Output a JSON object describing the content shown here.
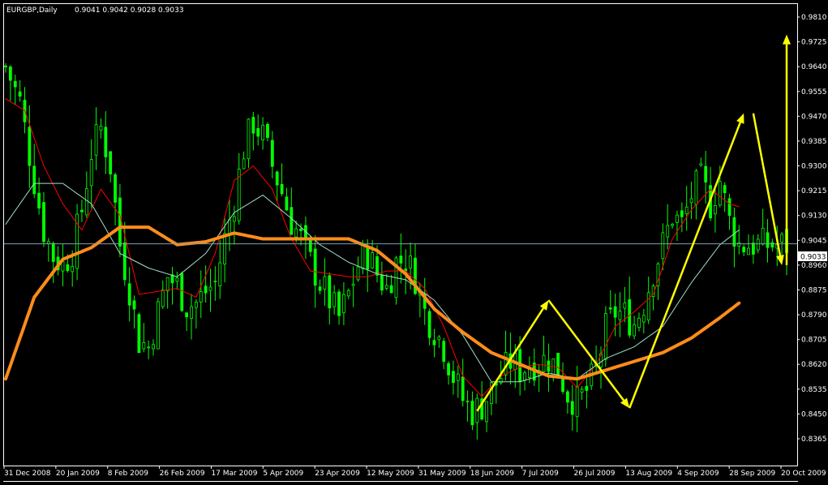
{
  "window": {
    "title": "EURGBP,Daily",
    "ohlc": "0.9041 0.9042 0.9028 0.9033"
  },
  "chart_data": {
    "type": "candlestick",
    "symbol": "EURGBP",
    "timeframe": "Daily",
    "current_price": "0.9033",
    "ylim": [
      0.8365,
      0.983
    ],
    "y_ticks": [
      "0.9810",
      "0.9725",
      "0.9640",
      "0.9555",
      "0.9470",
      "0.9385",
      "0.9300",
      "0.9215",
      "0.9130",
      "0.9045",
      "0.8960",
      "0.8875",
      "0.8790",
      "0.8705",
      "0.8620",
      "0.8535",
      "0.8450",
      "0.8365"
    ],
    "x_ticks": [
      "31 Dec 2008",
      "20 Jan 2009",
      "8 Feb 2009",
      "26 Feb 2009",
      "17 Mar 2009",
      "5 Apr 2009",
      "23 Apr 2009",
      "12 May 2009",
      "31 May 2009",
      "18 Jun 2009",
      "7 Jul 2009",
      "26 Jul 2009",
      "13 Aug 2009",
      "4 Sep 2009",
      "28 Sep 2009",
      "20 Oct 2009"
    ],
    "grid": false,
    "colors": {
      "background": "#000000",
      "candles": "#00ff00",
      "ma_fast": "#ff0000",
      "ma_mid": "#9fe0c8",
      "ma_slow": "#ff8c1a",
      "arrows": "#ffff00",
      "price_line": "#7f9fb0",
      "axis": "#ffffff"
    },
    "close_path": [
      [
        0,
        0.964
      ],
      [
        3,
        0.952
      ],
      [
        6,
        0.925
      ],
      [
        8,
        0.908
      ],
      [
        10,
        0.899
      ],
      [
        12,
        0.896
      ],
      [
        14,
        0.901
      ],
      [
        16,
        0.915
      ],
      [
        18,
        0.935
      ],
      [
        20,
        0.943
      ],
      [
        22,
        0.93
      ],
      [
        24,
        0.903
      ],
      [
        26,
        0.888
      ],
      [
        28,
        0.87
      ],
      [
        30,
        0.868
      ],
      [
        32,
        0.88
      ],
      [
        34,
        0.892
      ],
      [
        36,
        0.889
      ],
      [
        38,
        0.882
      ],
      [
        40,
        0.883
      ],
      [
        42,
        0.887
      ],
      [
        44,
        0.89
      ],
      [
        46,
        0.905
      ],
      [
        48,
        0.918
      ],
      [
        50,
        0.936
      ],
      [
        52,
        0.945
      ],
      [
        54,
        0.94
      ],
      [
        56,
        0.93
      ],
      [
        58,
        0.921
      ],
      [
        60,
        0.911
      ],
      [
        62,
        0.905
      ],
      [
        64,
        0.897
      ],
      [
        66,
        0.89
      ],
      [
        68,
        0.884
      ],
      [
        70,
        0.878
      ],
      [
        72,
        0.886
      ],
      [
        74,
        0.896
      ],
      [
        76,
        0.9
      ],
      [
        78,
        0.893
      ],
      [
        80,
        0.888
      ],
      [
        82,
        0.897
      ],
      [
        84,
        0.898
      ],
      [
        86,
        0.892
      ],
      [
        88,
        0.88
      ],
      [
        90,
        0.874
      ],
      [
        92,
        0.868
      ],
      [
        94,
        0.858
      ],
      [
        96,
        0.85
      ],
      [
        98,
        0.846
      ],
      [
        100,
        0.848
      ],
      [
        102,
        0.853
      ],
      [
        104,
        0.858
      ],
      [
        106,
        0.863
      ],
      [
        108,
        0.86
      ],
      [
        110,
        0.862
      ],
      [
        112,
        0.863
      ],
      [
        114,
        0.864
      ],
      [
        116,
        0.86
      ],
      [
        118,
        0.852
      ],
      [
        120,
        0.849
      ],
      [
        122,
        0.853
      ],
      [
        124,
        0.86
      ],
      [
        126,
        0.874
      ],
      [
        128,
        0.88
      ],
      [
        130,
        0.879
      ],
      [
        132,
        0.876
      ],
      [
        134,
        0.883
      ],
      [
        136,
        0.894
      ],
      [
        138,
        0.903
      ],
      [
        140,
        0.913
      ],
      [
        142,
        0.91
      ],
      [
        144,
        0.92
      ],
      [
        146,
        0.925
      ],
      [
        148,
        0.917
      ],
      [
        150,
        0.925
      ],
      [
        152,
        0.911
      ],
      [
        154,
        0.903
      ]
    ],
    "moving_averages": [
      {
        "name": "ma_fast",
        "points": [
          [
            0,
            0.953
          ],
          [
            4,
            0.949
          ],
          [
            8,
            0.93
          ],
          [
            12,
            0.917
          ],
          [
            16,
            0.908
          ],
          [
            20,
            0.922
          ],
          [
            24,
            0.913
          ],
          [
            28,
            0.886
          ],
          [
            32,
            0.887
          ],
          [
            36,
            0.888
          ],
          [
            40,
            0.885
          ],
          [
            44,
            0.9
          ],
          [
            48,
            0.925
          ],
          [
            52,
            0.93
          ],
          [
            56,
            0.922
          ],
          [
            60,
            0.905
          ],
          [
            64,
            0.894
          ],
          [
            68,
            0.893
          ],
          [
            72,
            0.892
          ],
          [
            76,
            0.892
          ],
          [
            80,
            0.894
          ],
          [
            84,
            0.894
          ],
          [
            88,
            0.888
          ],
          [
            92,
            0.875
          ],
          [
            96,
            0.858
          ],
          [
            100,
            0.851
          ],
          [
            104,
            0.858
          ],
          [
            108,
            0.861
          ],
          [
            112,
            0.862
          ],
          [
            116,
            0.861
          ],
          [
            120,
            0.854
          ],
          [
            124,
            0.862
          ],
          [
            128,
            0.875
          ],
          [
            132,
            0.88
          ],
          [
            136,
            0.886
          ],
          [
            140,
            0.905
          ],
          [
            144,
            0.915
          ],
          [
            148,
            0.922
          ],
          [
            152,
            0.917
          ],
          [
            154,
            0.916
          ]
        ]
      },
      {
        "name": "ma_mid",
        "points": [
          [
            0,
            0.91
          ],
          [
            6,
            0.924
          ],
          [
            12,
            0.924
          ],
          [
            18,
            0.917
          ],
          [
            24,
            0.9
          ],
          [
            30,
            0.895
          ],
          [
            36,
            0.892
          ],
          [
            42,
            0.9
          ],
          [
            48,
            0.914
          ],
          [
            54,
            0.92
          ],
          [
            60,
            0.912
          ],
          [
            66,
            0.903
          ],
          [
            72,
            0.897
          ],
          [
            78,
            0.893
          ],
          [
            84,
            0.891
          ],
          [
            90,
            0.884
          ],
          [
            96,
            0.872
          ],
          [
            102,
            0.856
          ],
          [
            108,
            0.856
          ],
          [
            114,
            0.859
          ],
          [
            120,
            0.857
          ],
          [
            126,
            0.864
          ],
          [
            132,
            0.868
          ],
          [
            138,
            0.875
          ],
          [
            144,
            0.89
          ],
          [
            150,
            0.903
          ],
          [
            154,
            0.908
          ]
        ]
      },
      {
        "name": "ma_slow",
        "points": [
          [
            0,
            0.857
          ],
          [
            6,
            0.885
          ],
          [
            12,
            0.898
          ],
          [
            18,
            0.902
          ],
          [
            24,
            0.909
          ],
          [
            30,
            0.909
          ],
          [
            36,
            0.903
          ],
          [
            42,
            0.904
          ],
          [
            48,
            0.907
          ],
          [
            54,
            0.905
          ],
          [
            60,
            0.905
          ],
          [
            66,
            0.905
          ],
          [
            72,
            0.905
          ],
          [
            78,
            0.901
          ],
          [
            84,
            0.893
          ],
          [
            90,
            0.881
          ],
          [
            96,
            0.873
          ],
          [
            102,
            0.866
          ],
          [
            108,
            0.862
          ],
          [
            114,
            0.858
          ],
          [
            120,
            0.857
          ],
          [
            126,
            0.86
          ],
          [
            132,
            0.863
          ],
          [
            138,
            0.866
          ],
          [
            144,
            0.871
          ],
          [
            150,
            0.878
          ],
          [
            154,
            0.883
          ]
        ]
      }
    ],
    "annotations": [
      {
        "type": "arrow",
        "from": [
          99,
          0.846
        ],
        "to": [
          114,
          0.884
        ]
      },
      {
        "type": "arrow",
        "from": [
          114,
          0.884
        ],
        "to": [
          131,
          0.847
        ]
      },
      {
        "type": "arrow",
        "from": [
          131,
          0.847
        ],
        "to": [
          155,
          0.948
        ]
      },
      {
        "type": "arrow",
        "from": [
          157,
          0.948
        ],
        "to": [
          163,
          0.896
        ]
      },
      {
        "type": "arrow",
        "from": [
          164,
          0.896
        ],
        "to": [
          164,
          0.975
        ]
      }
    ]
  }
}
